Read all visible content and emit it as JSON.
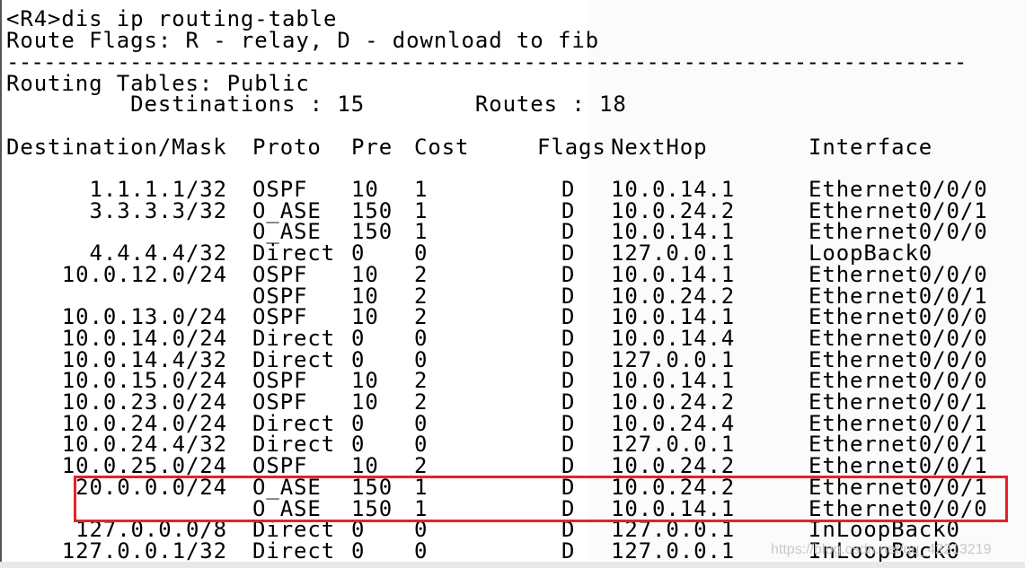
{
  "terminal": {
    "command_line": "<R4>dis ip routing-table",
    "flags_legend": "Route Flags: R - relay, D - download to fib",
    "separator": "------------------------------------------------------------------------------",
    "table_name": "Routing Tables: Public",
    "destinations": "         Destinations : 15        Routes : 18",
    "columns": [
      "Destination/Mask",
      "Proto",
      "Pre",
      "Cost",
      "Flags",
      "NextHop",
      "Interface"
    ],
    "rows": [
      {
        "dest": "1.1.1.1/32",
        "proto": "OSPF",
        "pre": "10",
        "cost": "1",
        "flags": "D",
        "next": "10.0.14.1",
        "iface": "Ethernet0/0/0"
      },
      {
        "dest": "3.3.3.3/32",
        "proto": "O_ASE",
        "pre": "150",
        "cost": "1",
        "flags": "D",
        "next": "10.0.24.2",
        "iface": "Ethernet0/0/1"
      },
      {
        "dest": "",
        "proto": "O_ASE",
        "pre": "150",
        "cost": "1",
        "flags": "D",
        "next": "10.0.14.1",
        "iface": "Ethernet0/0/0"
      },
      {
        "dest": "4.4.4.4/32",
        "proto": "Direct",
        "pre": "0",
        "cost": "0",
        "flags": "D",
        "next": "127.0.0.1",
        "iface": "LoopBack0"
      },
      {
        "dest": "10.0.12.0/24",
        "proto": "OSPF",
        "pre": "10",
        "cost": "2",
        "flags": "D",
        "next": "10.0.14.1",
        "iface": "Ethernet0/0/0"
      },
      {
        "dest": "",
        "proto": "OSPF",
        "pre": "10",
        "cost": "2",
        "flags": "D",
        "next": "10.0.24.2",
        "iface": "Ethernet0/0/1"
      },
      {
        "dest": "10.0.13.0/24",
        "proto": "OSPF",
        "pre": "10",
        "cost": "2",
        "flags": "D",
        "next": "10.0.14.1",
        "iface": "Ethernet0/0/0"
      },
      {
        "dest": "10.0.14.0/24",
        "proto": "Direct",
        "pre": "0",
        "cost": "0",
        "flags": "D",
        "next": "10.0.14.4",
        "iface": "Ethernet0/0/0"
      },
      {
        "dest": "10.0.14.4/32",
        "proto": "Direct",
        "pre": "0",
        "cost": "0",
        "flags": "D",
        "next": "127.0.0.1",
        "iface": "Ethernet0/0/0"
      },
      {
        "dest": "10.0.15.0/24",
        "proto": "OSPF",
        "pre": "10",
        "cost": "2",
        "flags": "D",
        "next": "10.0.14.1",
        "iface": "Ethernet0/0/0"
      },
      {
        "dest": "10.0.23.0/24",
        "proto": "OSPF",
        "pre": "10",
        "cost": "2",
        "flags": "D",
        "next": "10.0.24.2",
        "iface": "Ethernet0/0/1"
      },
      {
        "dest": "10.0.24.0/24",
        "proto": "Direct",
        "pre": "0",
        "cost": "0",
        "flags": "D",
        "next": "10.0.24.4",
        "iface": "Ethernet0/0/1"
      },
      {
        "dest": "10.0.24.4/32",
        "proto": "Direct",
        "pre": "0",
        "cost": "0",
        "flags": "D",
        "next": "127.0.0.1",
        "iface": "Ethernet0/0/1"
      },
      {
        "dest": "10.0.25.0/24",
        "proto": "OSPF",
        "pre": "10",
        "cost": "2",
        "flags": "D",
        "next": "10.0.24.2",
        "iface": "Ethernet0/0/1"
      },
      {
        "dest": "20.0.0.0/24",
        "proto": "O_ASE",
        "pre": "150",
        "cost": "1",
        "flags": "D",
        "next": "10.0.24.2",
        "iface": "Ethernet0/0/1"
      },
      {
        "dest": "",
        "proto": "O_ASE",
        "pre": "150",
        "cost": "1",
        "flags": "D",
        "next": "10.0.14.1",
        "iface": "Ethernet0/0/0"
      },
      {
        "dest": "127.0.0.0/8",
        "proto": "Direct",
        "pre": "0",
        "cost": "0",
        "flags": "D",
        "next": "127.0.0.1",
        "iface": "InLoopBack0"
      },
      {
        "dest": "127.0.0.1/32",
        "proto": "Direct",
        "pre": "0",
        "cost": "0",
        "flags": "D",
        "next": "127.0.0.1",
        "iface": "InLoopBack0"
      }
    ]
  },
  "highlight_color": "#e8202a",
  "watermark": "https://blog.csdn.net/qq_42213219"
}
